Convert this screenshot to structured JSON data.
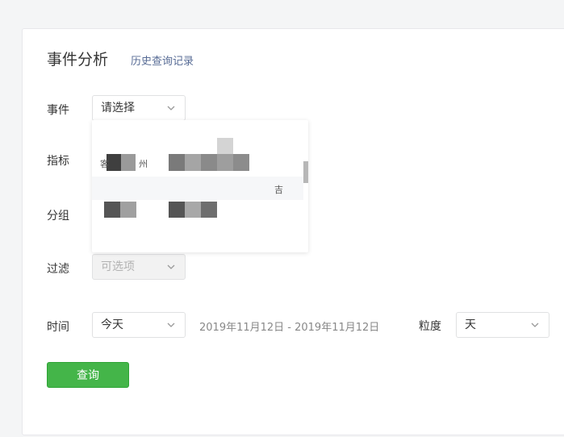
{
  "page": {
    "title": "事件分析",
    "history_link": "历史查询记录"
  },
  "form": {
    "event": {
      "label": "事件",
      "value": "请选择"
    },
    "metric": {
      "label": "指标"
    },
    "group": {
      "label": "分组"
    },
    "filter": {
      "label": "过滤",
      "placeholder": "可选项"
    },
    "time": {
      "label": "时间",
      "value": "今天",
      "range": "2019年11月12日 - 2019年11月12日"
    },
    "granularity": {
      "label": "粒度",
      "value": "天"
    },
    "query_button": "查询"
  },
  "dropdown": {
    "items": [
      "客",
      "州",
      "吉"
    ]
  },
  "colors": {
    "primary": "#44b549",
    "link": "#576b95",
    "text": "#353535",
    "muted": "#888888"
  }
}
